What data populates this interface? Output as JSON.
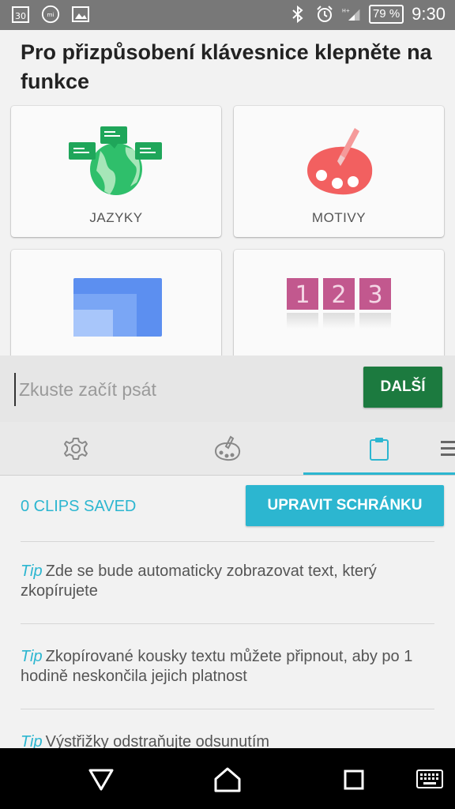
{
  "status_bar": {
    "icons": [
      "calendar-icon",
      "mi-icon",
      "gallery-icon",
      "bluetooth-icon",
      "alarm-icon",
      "signal-icon"
    ],
    "calendar_day": "30",
    "battery": "79 %",
    "time": "9:30"
  },
  "heading": "Pro přizpůsobení klávesnice klepněte na funkce",
  "cards": [
    {
      "label": "JAZYKY",
      "icon": "languages-globe-icon"
    },
    {
      "label": "MOTIVY",
      "icon": "palette-icon"
    },
    {
      "label": "",
      "icon": "layout-windows-icon"
    },
    {
      "label": "",
      "icon": "number-row-icon",
      "digits": [
        "1",
        "2",
        "3"
      ]
    }
  ],
  "input": {
    "placeholder": "Zkuste začít psát",
    "value": ""
  },
  "next_button": "DALŠÍ",
  "toolbar": {
    "tabs": [
      "gear-icon",
      "palette-icon",
      "clipboard-icon",
      "menu-icon"
    ],
    "active_tab": 2
  },
  "clipboard": {
    "count_label": "0 CLIPS SAVED",
    "edit_button": "UPRAVIT SCHRÁNKU",
    "tips": [
      {
        "tip": "Tip",
        "text": "Zde se bude automaticky zobrazovat text, který zkopírujete"
      },
      {
        "tip": "Tip",
        "text": "Zkopírované kousky textu můžete připnout, aby po 1 hodině neskončila jejich platnost"
      },
      {
        "tip": "Tip",
        "text": "Výstřižky odstraňujte odsunutím"
      }
    ]
  },
  "colors": {
    "accent": "#2cb6d0",
    "green": "#1c7a3f",
    "palette": "#f26060",
    "tile": "#c2588e"
  }
}
